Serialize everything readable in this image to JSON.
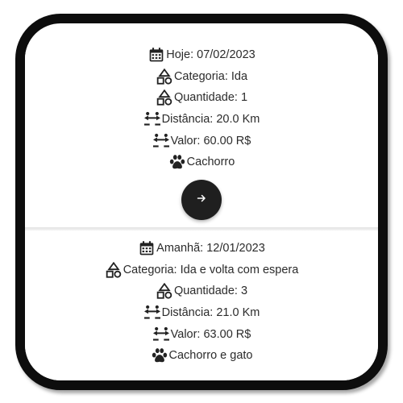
{
  "cards": [
    {
      "date": "Hoje: 07/02/2023",
      "category": "Categoria: Ida",
      "quantity": "Quantidade: 1",
      "distance": "Distância: 20.0 Km",
      "value": "Valor: 60.00 R$",
      "pet": "Cachorro",
      "action_icon": "arrow-right-icon"
    },
    {
      "date": "Amanhã: 12/01/2023",
      "category": "Categoria: Ida e volta com espera",
      "quantity": "Quantidade: 3",
      "distance": "Distância: 21.0 Km",
      "value": "Valor: 63.00 R$",
      "pet": "Cachorro e gato",
      "action_icon": "arrow-right-icon"
    }
  ],
  "icons": {
    "date": "calendar-icon",
    "category": "shapes-icon",
    "quantity": "shapes-icon",
    "distance": "arrows-swap-icon",
    "value": "arrows-swap-icon",
    "pet": "paw-icon"
  },
  "colors": {
    "frame": "#0d0d0d",
    "fab": "#1f1f1f",
    "text": "#2b2b2b",
    "icon": "#222222"
  }
}
